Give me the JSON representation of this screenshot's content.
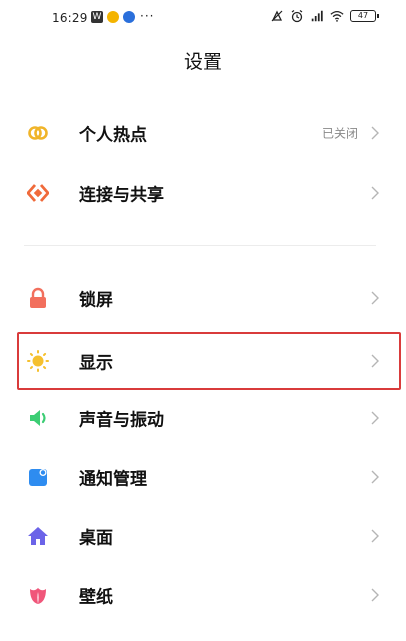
{
  "status_bar": {
    "time": "16:29",
    "more": "···",
    "app_badge": "W",
    "battery": "47"
  },
  "header": {
    "title": "设置"
  },
  "section1": [
    {
      "label": "个人热点",
      "value": "已关闭",
      "icon": "hotspot-icon",
      "color": "#f0b429"
    },
    {
      "label": "连接与共享",
      "icon": "share-icon",
      "color": "#f06a3b"
    }
  ],
  "section2": [
    {
      "label": "锁屏",
      "icon": "lock-icon",
      "color": "#f26f5d"
    },
    {
      "label": "显示",
      "icon": "sun-icon",
      "color": "#f5c02e"
    },
    {
      "label": "声音与振动",
      "icon": "speaker-icon",
      "color": "#3ccd74"
    },
    {
      "label": "通知管理",
      "icon": "notification-icon",
      "color": "#2e8cf0"
    },
    {
      "label": "桌面",
      "icon": "home-icon",
      "color": "#6b63e8"
    },
    {
      "label": "壁纸",
      "icon": "flower-icon",
      "color": "#f0567a"
    }
  ],
  "colors": {
    "highlight": "#d93b3b",
    "chevron": "#b5b5b5"
  }
}
